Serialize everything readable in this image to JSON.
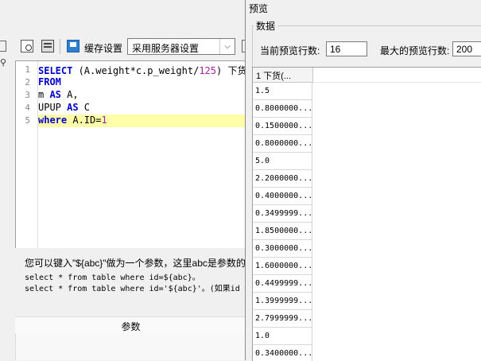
{
  "toolbar": {
    "cache_label": "缓存设置",
    "cache_select_value": "采用服务器设置"
  },
  "editor": {
    "lines": [
      {
        "num": "1",
        "parts": [
          {
            "t": "SELECT",
            "c": "kw"
          },
          {
            "t": " (A.weight*c.p_weight/",
            "c": "fn"
          },
          {
            "t": "125",
            "c": "num"
          },
          {
            "t": ") 下货",
            "c": "fn"
          }
        ]
      },
      {
        "num": "2",
        "parts": [
          {
            "t": "FROM",
            "c": "kw"
          }
        ]
      },
      {
        "num": "3",
        "parts": [
          {
            "t": "m ",
            "c": "fn"
          },
          {
            "t": "AS",
            "c": "kw"
          },
          {
            "t": " A,",
            "c": "fn"
          }
        ]
      },
      {
        "num": "4",
        "parts": [
          {
            "t": "UPUP ",
            "c": "fn"
          },
          {
            "t": "AS",
            "c": "kw"
          },
          {
            "t": " C",
            "c": "fn"
          }
        ]
      },
      {
        "num": "5",
        "parts": [
          {
            "t": "where",
            "c": "kw"
          },
          {
            "t": " A.ID=",
            "c": "fn"
          },
          {
            "t": "1",
            "c": "num"
          }
        ],
        "highlight": true
      }
    ]
  },
  "help": {
    "line1": "您可以键入\"${abc}\"做为一个参数，这里abc是参数的",
    "line2": "select * from table where id=${abc}。",
    "line3": "select * from table where id='${abc}'。(如果id"
  },
  "params": {
    "label": "参数"
  },
  "preview": {
    "title": "预览",
    "group_label": "数据",
    "current_rows_label": "当前预览行数:",
    "current_rows_value": "16",
    "max_rows_label": "最大的预览行数:",
    "max_rows_value": "200",
    "column_header": "1 下货(...",
    "rows": [
      "1.5",
      "0.8000000...",
      "0.1500000...",
      "0.8000000...",
      "5.0",
      "2.2000000...",
      "0.4000000...",
      "0.3499999...",
      "1.8500000...",
      "0.3000000...",
      "1.6000000...",
      "0.4499999...",
      "1.3999999...",
      "2.7999999...",
      "1.0",
      "0.3400000..."
    ]
  }
}
